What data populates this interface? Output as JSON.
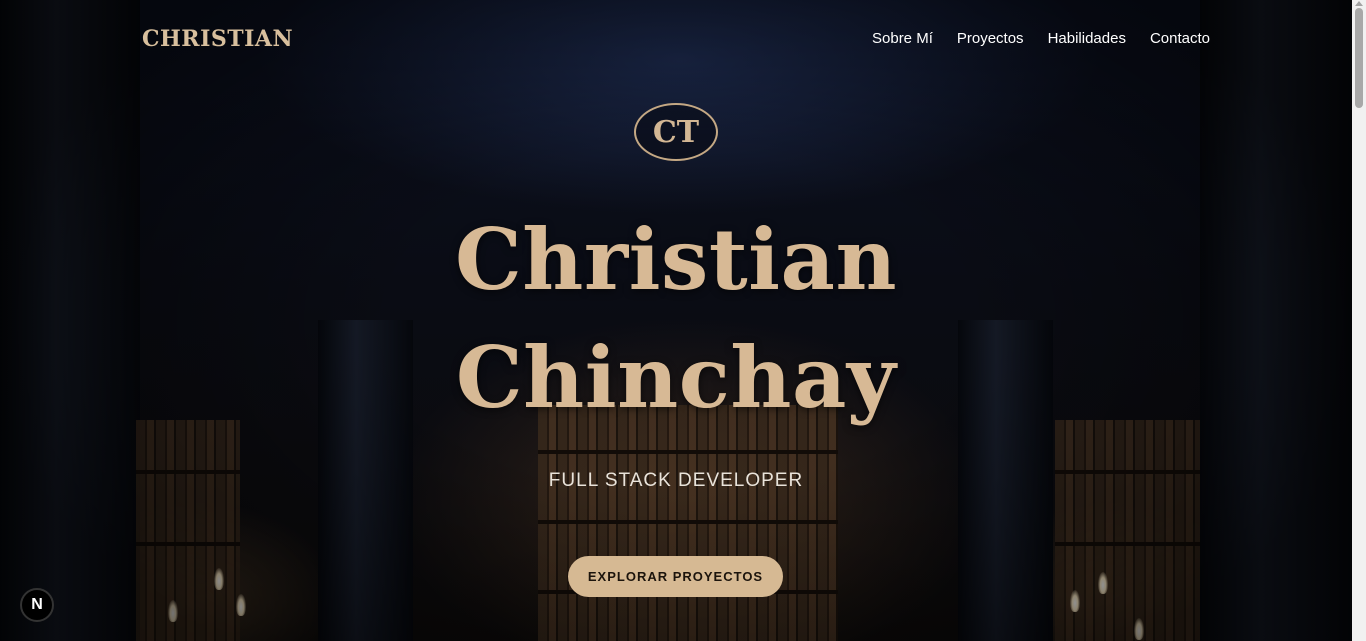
{
  "nav": {
    "brand": "CHRISTIAN",
    "links": [
      "Sobre Mí",
      "Proyectos",
      "Habilidades",
      "Contacto"
    ]
  },
  "hero": {
    "monogram": "CT",
    "title_line1": "Christian",
    "title_line2": "Chinchay",
    "subtitle": "FULL STACK DEVELOPER",
    "cta_label": "EXPLORAR PROYECTOS"
  },
  "dev_badge": "N",
  "colors": {
    "accent": "#d6b993",
    "background": "#07090f",
    "text": "#ffffff"
  }
}
